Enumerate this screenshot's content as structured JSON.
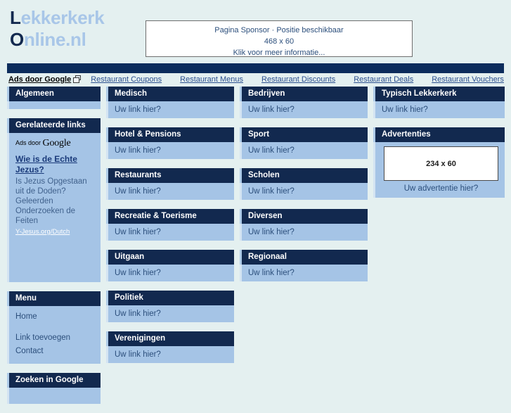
{
  "site": {
    "logo_line1_cap": "L",
    "logo_line1_rest": "ekkerkerk",
    "logo_line2_cap": "O",
    "logo_line2_rest": "nline.nl"
  },
  "sponsor": {
    "line1": "Pagina Sponsor · Positie beschikbaar",
    "line2": "468 x 60",
    "line3": "Klik voor meer informatie..."
  },
  "ads_strip": {
    "label": "Ads door Google",
    "icon": "popout-icon",
    "links": [
      "Restaurant Coupons",
      "Restaurant Menus",
      "Restaurant Discounts",
      "Restaurant Deals",
      "Restaurant Vouchers"
    ]
  },
  "sidebar": {
    "algemeen": {
      "title": "Algemeen"
    },
    "gerelateerde": {
      "title": "Gerelateerde links",
      "ads_door": "Ads door",
      "google_word": "Google",
      "ad_title": "Wie is de Echte Jezus?",
      "ad_text": "Is Jezus Opgestaan uit de Doden? Geleerden Onderzoeken de Feiten",
      "ad_url": "Y-Jesus.org/Dutch"
    },
    "menu": {
      "title": "Menu",
      "items": [
        "Home",
        "Link toevoegen",
        "Contact"
      ]
    },
    "zoeken": {
      "title": "Zoeken in Google"
    }
  },
  "link_text": "Uw link hier?",
  "columns": {
    "mid1": [
      {
        "title": "Medisch"
      },
      {
        "title": "Hotel & Pensions"
      },
      {
        "title": "Restaurants"
      },
      {
        "title": "Recreatie & Toerisme"
      },
      {
        "title": "Uitgaan"
      },
      {
        "title": "Politiek"
      },
      {
        "title": "Verenigingen"
      }
    ],
    "mid2": [
      {
        "title": "Bedrijven"
      },
      {
        "title": "Sport"
      },
      {
        "title": "Scholen"
      },
      {
        "title": "Diversen"
      },
      {
        "title": "Regionaal"
      }
    ],
    "right": [
      {
        "title": "Typisch Lekkerkerk"
      }
    ]
  },
  "advertenties": {
    "title": "Advertenties",
    "box_size": "234 x 60",
    "caption": "Uw advertentie hier?"
  },
  "colors": {
    "page_bg": "#e4f0f0",
    "navy": "#12294f",
    "panel_blue": "#a5c4e6",
    "logo_light": "#a8c6e8"
  }
}
